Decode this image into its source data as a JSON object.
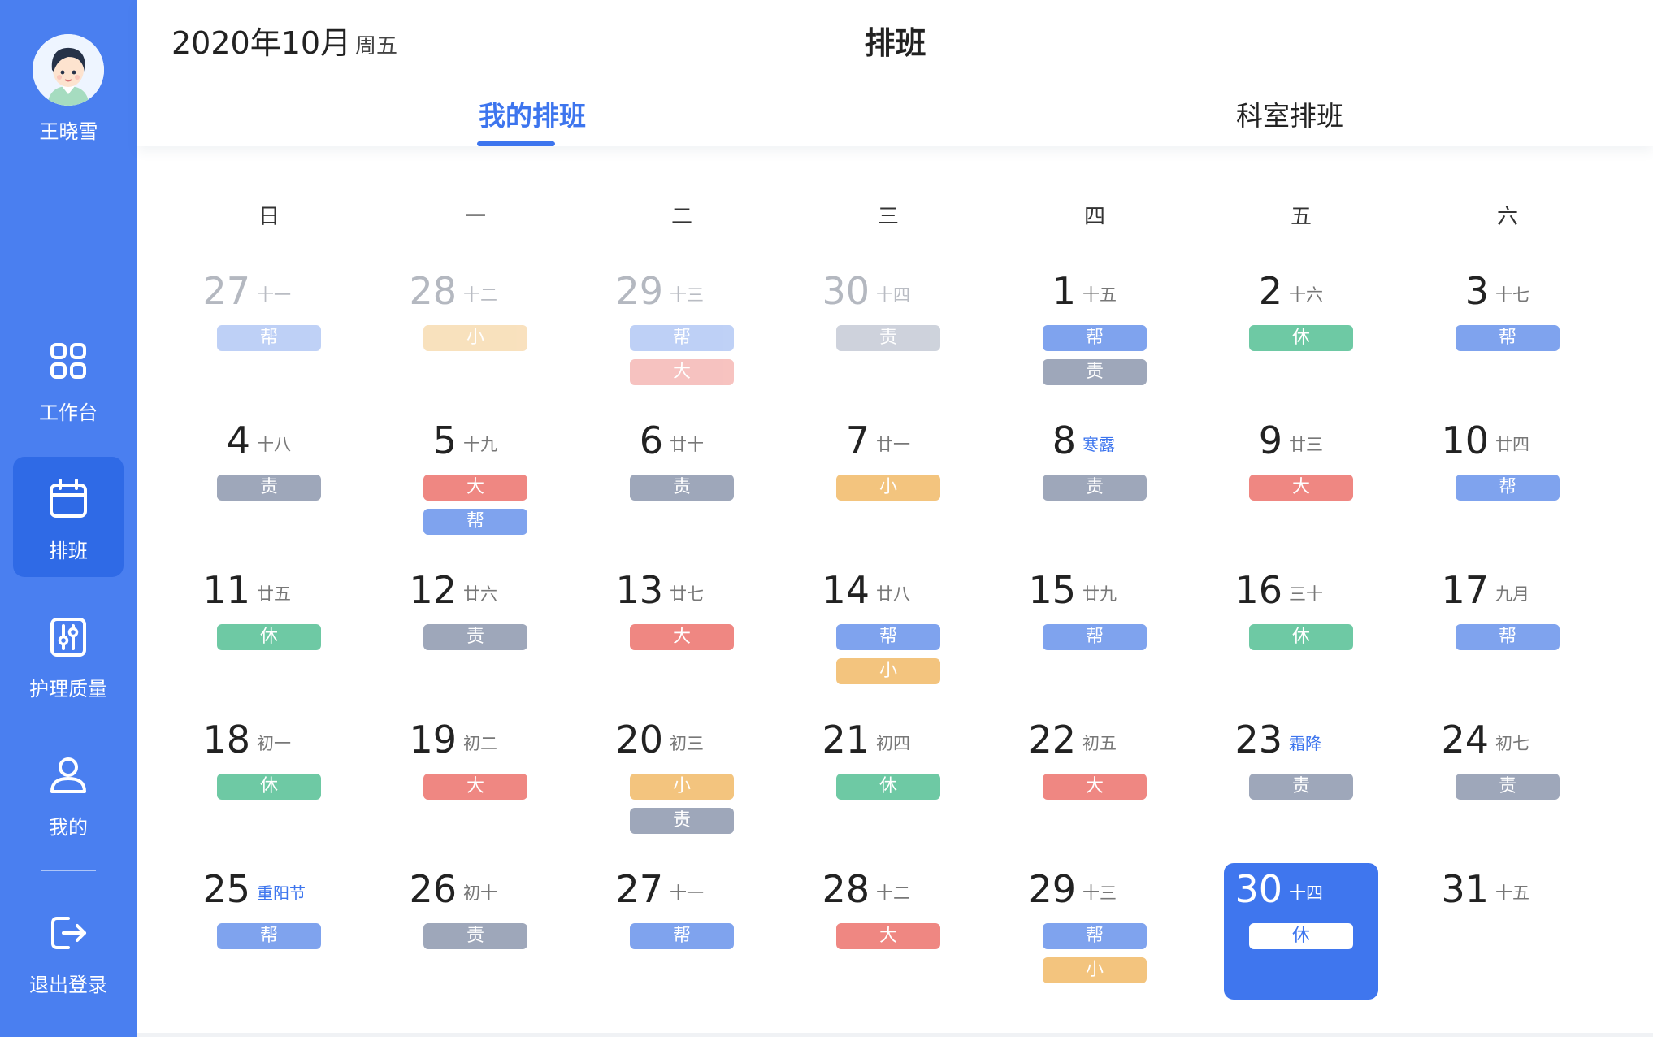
{
  "sidebar": {
    "user_name": "王晓雪",
    "items": [
      {
        "key": "workbench",
        "label": "工作台",
        "icon": "grid-icon",
        "active": false
      },
      {
        "key": "schedule",
        "label": "排班",
        "icon": "calendar-icon",
        "active": true
      },
      {
        "key": "nursing-quality",
        "label": "护理质量",
        "icon": "sliders-icon",
        "active": false
      },
      {
        "key": "mine",
        "label": "我的",
        "icon": "user-icon",
        "active": false
      }
    ],
    "logout_label": "退出登录",
    "logout_icon": "logout-icon"
  },
  "header": {
    "date_title": "2020年10月",
    "weekday": "周五",
    "page_title": "排班",
    "tabs": [
      {
        "label": "我的排班",
        "active": true
      },
      {
        "label": "科室排班",
        "active": false
      }
    ]
  },
  "calendar": {
    "weekdays": [
      "日",
      "一",
      "二",
      "三",
      "四",
      "五",
      "六"
    ],
    "shift_colors": {
      "帮": "#7fa3ee",
      "小": "#f3c47e",
      "大": "#ef8782",
      "责": "#9ea7ba",
      "休": "#6ec9a4"
    },
    "today": "30",
    "days": [
      {
        "day": "27",
        "lunar": "十一",
        "shifts": [
          "帮"
        ],
        "outside": true
      },
      {
        "day": "28",
        "lunar": "十二",
        "shifts": [
          "小"
        ],
        "outside": true
      },
      {
        "day": "29",
        "lunar": "十三",
        "shifts": [
          "帮",
          "大"
        ],
        "outside": true
      },
      {
        "day": "30",
        "lunar": "十四",
        "shifts": [
          "责"
        ],
        "outside": true
      },
      {
        "day": "1",
        "lunar": "十五",
        "shifts": [
          "帮",
          "责"
        ]
      },
      {
        "day": "2",
        "lunar": "十六",
        "shifts": [
          "休"
        ]
      },
      {
        "day": "3",
        "lunar": "十七",
        "shifts": [
          "帮"
        ]
      },
      {
        "day": "4",
        "lunar": "十八",
        "shifts": [
          "责"
        ]
      },
      {
        "day": "5",
        "lunar": "十九",
        "shifts": [
          "大",
          "帮"
        ]
      },
      {
        "day": "6",
        "lunar": "廿十",
        "shifts": [
          "责"
        ]
      },
      {
        "day": "7",
        "lunar": "廿一",
        "shifts": [
          "小"
        ]
      },
      {
        "day": "8",
        "lunar": "寒露",
        "shifts": [
          "责"
        ],
        "festival": true
      },
      {
        "day": "9",
        "lunar": "廿三",
        "shifts": [
          "大"
        ]
      },
      {
        "day": "10",
        "lunar": "廿四",
        "shifts": [
          "帮"
        ]
      },
      {
        "day": "11",
        "lunar": "廿五",
        "shifts": [
          "休"
        ]
      },
      {
        "day": "12",
        "lunar": "廿六",
        "shifts": [
          "责"
        ]
      },
      {
        "day": "13",
        "lunar": "廿七",
        "shifts": [
          "大"
        ]
      },
      {
        "day": "14",
        "lunar": "廿八",
        "shifts": [
          "帮",
          "小"
        ]
      },
      {
        "day": "15",
        "lunar": "廿九",
        "shifts": [
          "帮"
        ]
      },
      {
        "day": "16",
        "lunar": "三十",
        "shifts": [
          "休"
        ]
      },
      {
        "day": "17",
        "lunar": "九月",
        "shifts": [
          "帮"
        ]
      },
      {
        "day": "18",
        "lunar": "初一",
        "shifts": [
          "休"
        ]
      },
      {
        "day": "19",
        "lunar": "初二",
        "shifts": [
          "大"
        ]
      },
      {
        "day": "20",
        "lunar": "初三",
        "shifts": [
          "小",
          "责"
        ]
      },
      {
        "day": "21",
        "lunar": "初四",
        "shifts": [
          "休"
        ]
      },
      {
        "day": "22",
        "lunar": "初五",
        "shifts": [
          "大"
        ]
      },
      {
        "day": "23",
        "lunar": "霜降",
        "shifts": [
          "责"
        ],
        "festival": true
      },
      {
        "day": "24",
        "lunar": "初七",
        "shifts": [
          "责"
        ]
      },
      {
        "day": "25",
        "lunar": "重阳节",
        "shifts": [
          "帮"
        ],
        "festival": true
      },
      {
        "day": "26",
        "lunar": "初十",
        "shifts": [
          "责"
        ]
      },
      {
        "day": "27",
        "lunar": "十一",
        "shifts": [
          "帮"
        ]
      },
      {
        "day": "28",
        "lunar": "十二",
        "shifts": [
          "大"
        ]
      },
      {
        "day": "29",
        "lunar": "十三",
        "shifts": [
          "帮",
          "小"
        ]
      },
      {
        "day": "30",
        "lunar": "十四",
        "shifts": [
          "休"
        ],
        "today": true
      },
      {
        "day": "31",
        "lunar": "十五",
        "shifts": []
      }
    ]
  }
}
